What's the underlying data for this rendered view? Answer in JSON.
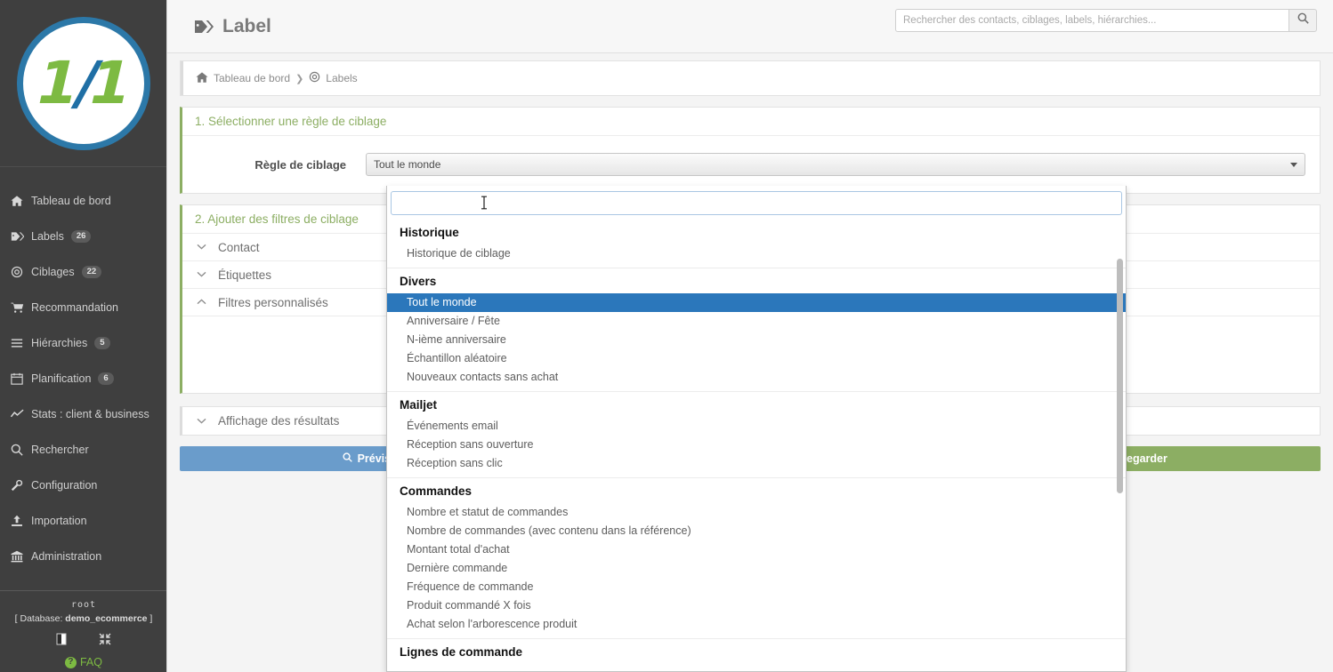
{
  "sidebar": {
    "logo": {
      "text_left": "1",
      "slash": "/",
      "text_right": "1"
    },
    "items": [
      {
        "label": "Tableau de bord",
        "icon": "home-icon",
        "badge": ""
      },
      {
        "label": "Labels",
        "icon": "tag-icon",
        "badge": "26"
      },
      {
        "label": "Ciblages",
        "icon": "target-icon",
        "badge": "22"
      },
      {
        "label": "Recommandation",
        "icon": "cart-icon",
        "badge": ""
      },
      {
        "label": "Hiérarchies",
        "icon": "list-icon",
        "badge": "5"
      },
      {
        "label": "Planification",
        "icon": "calendar-icon",
        "badge": "6"
      },
      {
        "label": "Stats : client & business",
        "icon": "chart-icon",
        "badge": ""
      },
      {
        "label": "Rechercher",
        "icon": "search-icon",
        "badge": ""
      },
      {
        "label": "Configuration",
        "icon": "wrench-icon",
        "badge": ""
      },
      {
        "label": "Importation",
        "icon": "upload-icon",
        "badge": ""
      },
      {
        "label": "Administration",
        "icon": "bank-icon",
        "badge": ""
      }
    ],
    "footer": {
      "user": "root",
      "database": "[ Database: demo_ecommerce ]",
      "database_prefix": "[ Database: ",
      "database_name": "demo_ecommerce",
      "database_suffix": " ]",
      "faq": "FAQ",
      "faq_badge": "?"
    }
  },
  "topbar": {
    "title": "Label",
    "title_icon": "tag-icon",
    "search": {
      "placeholder": "Rechercher des contacts, ciblages, labels, hiérarchies...",
      "value": "",
      "button_icon": "search-icon"
    }
  },
  "breadcrumb": {
    "home_icon": "home-icon",
    "items": [
      "Tableau de bord",
      "Labels"
    ],
    "separator": "❯",
    "second_icon": "target-icon"
  },
  "step1": {
    "title": "1. Sélectionner une règle de ciblage",
    "field_label": "Règle de ciblage",
    "field_value": "Tout le monde"
  },
  "step2": {
    "title": "2. Ajouter des filtres de ciblage",
    "accordions": [
      {
        "label": "Contact",
        "expanded": false
      },
      {
        "label": "Étiquettes",
        "expanded": false
      },
      {
        "label": "Filtres personnalisés",
        "expanded": true
      }
    ]
  },
  "results": {
    "label": "Affichage des résultats",
    "expanded": false
  },
  "actions": {
    "preview": "Prévisualiser",
    "preview_icon": "search-icon",
    "save": "Sauvegarder",
    "save_icon": "download-icon"
  },
  "dropdown": {
    "search_value": "",
    "search_placeholder": "",
    "selected": "Tout le monde",
    "groups": [
      {
        "title": "Historique",
        "items": [
          "Historique de ciblage"
        ]
      },
      {
        "title": "Divers",
        "items": [
          "Tout le monde",
          "Anniversaire / Fête",
          "N-ième anniversaire",
          "Échantillon aléatoire",
          "Nouveaux contacts sans achat"
        ]
      },
      {
        "title": "Mailjet",
        "items": [
          "Événements email",
          "Réception sans ouverture",
          "Réception sans clic"
        ]
      },
      {
        "title": "Commandes",
        "items": [
          "Nombre et statut de commandes",
          "Nombre de commandes (avec contenu dans la référence)",
          "Montant total d'achat",
          "Dernière commande",
          "Fréquence de commande",
          "Produit commandé X fois",
          "Achat selon l'arborescence produit"
        ]
      },
      {
        "title": "Lignes de commande",
        "items": []
      }
    ]
  },
  "colors": {
    "sidebar_bg": "#3f3f3f",
    "accent_green": "#8cae63",
    "accent_blue": "#2b77bb",
    "preview_blue": "#6a9ccb",
    "logo_green": "#7dba42",
    "logo_blue": "#2c78a8"
  }
}
